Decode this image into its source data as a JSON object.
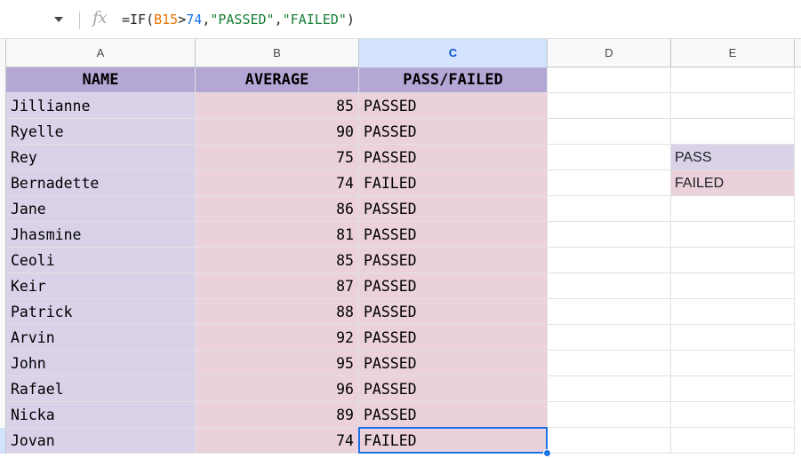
{
  "formula_bar": {
    "icon": "fx-icon",
    "formula_prefix": "=IF(",
    "formula_ref": "B15",
    "formula_op": ">",
    "formula_num": "74",
    "formula_comma1": ",",
    "formula_str1": "\"PASSED\"",
    "formula_comma2": ",",
    "formula_str2": "\"FAILED\"",
    "formula_suffix": ")"
  },
  "columns": [
    "A",
    "B",
    "C",
    "D",
    "E"
  ],
  "selected_column": "C",
  "headers": {
    "name": "NAME",
    "average": "AVERAGE",
    "result": "PASS/FAILED"
  },
  "rows": [
    {
      "name": "Jillianne",
      "average": "85",
      "result": "PASSED"
    },
    {
      "name": "Ryelle",
      "average": "90",
      "result": "PASSED"
    },
    {
      "name": "Rey",
      "average": "75",
      "result": "PASSED"
    },
    {
      "name": "Bernadette",
      "average": "74",
      "result": "FAILED"
    },
    {
      "name": "Jane",
      "average": "86",
      "result": "PASSED"
    },
    {
      "name": "Jhasmine",
      "average": "81",
      "result": "PASSED"
    },
    {
      "name": "Ceoli",
      "average": "85",
      "result": "PASSED"
    },
    {
      "name": "Keir",
      "average": "87",
      "result": "PASSED"
    },
    {
      "name": "Patrick",
      "average": "88",
      "result": "PASSED"
    },
    {
      "name": "Arvin",
      "average": "92",
      "result": "PASSED"
    },
    {
      "name": "John",
      "average": "95",
      "result": "PASSED"
    },
    {
      "name": "Rafael",
      "average": "96",
      "result": "PASSED"
    },
    {
      "name": "Nicka",
      "average": "89",
      "result": "PASSED"
    },
    {
      "name": "Jovan",
      "average": "74",
      "result": "FAILED"
    }
  ],
  "legend": {
    "pass": "PASS",
    "failed": "FAILED"
  },
  "colors": {
    "header_fill": "#b4a7d6",
    "name_fill": "#d9d2e9",
    "value_fill": "#ead1dc",
    "selection": "#1a73e8"
  }
}
